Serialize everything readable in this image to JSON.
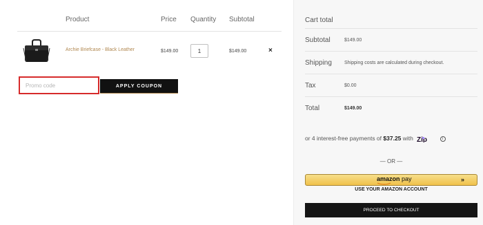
{
  "cart": {
    "headers": {
      "product": "Product",
      "price": "Price",
      "quantity": "Quantity",
      "subtotal": "Subtotal"
    },
    "items": [
      {
        "name": "Archie Briefcase - Black Leather",
        "price": "$149.00",
        "quantity": "1",
        "subtotal": "$149.00",
        "remove": "×",
        "image": "black-leather-briefcase"
      }
    ],
    "promo_placeholder": "Promo code",
    "apply_label": "APPLY COUPON"
  },
  "totals": {
    "title": "Cart total",
    "rows": [
      {
        "label": "Subtotal",
        "value": "$149.00"
      },
      {
        "label": "Shipping",
        "value": "Shipping costs are calculated during checkout."
      },
      {
        "label": "Tax",
        "value": "$0.00"
      },
      {
        "label": "Total",
        "value": "$149.00"
      }
    ],
    "zip": {
      "prefix": "or 4 interest-free payments of",
      "amount": "$37.25",
      "suffix": "with",
      "logo": "Zip",
      "info_icon": "i"
    },
    "or_text": "— OR —",
    "amazon": {
      "brand": "amazon",
      "pay": "pay",
      "arrows": "»",
      "caption": "USE YOUR AMAZON ACCOUNT"
    },
    "checkout_label": "PROCEED TO CHECKOUT"
  },
  "colors": {
    "accent": "#b0874f",
    "promo_border": "#d62a2a",
    "dark_button": "#111111",
    "amazon_yellow": "#f0c14b",
    "zip_purple": "#7a35e8"
  }
}
